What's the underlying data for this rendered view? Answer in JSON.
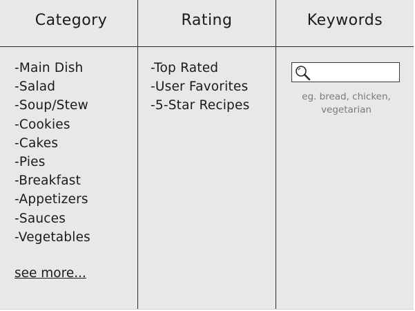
{
  "columns": {
    "category": {
      "title": "Category",
      "items": [
        "-Main Dish",
        "-Salad",
        "-Soup/Stew",
        "-Cookies",
        "-Cakes",
        "-Pies",
        "-Breakfast",
        "-Appetizers",
        "-Sauces",
        "-Vegetables"
      ],
      "see_more": "see more..."
    },
    "rating": {
      "title": "Rating",
      "items": [
        "-Top Rated",
        "-User Favorites",
        "-5-Star Recipes"
      ]
    },
    "keywords": {
      "title": "Keywords",
      "search_value": "",
      "search_icon": "magnifying-glass",
      "hint": "eg. bread, chicken, vegetarian"
    }
  }
}
